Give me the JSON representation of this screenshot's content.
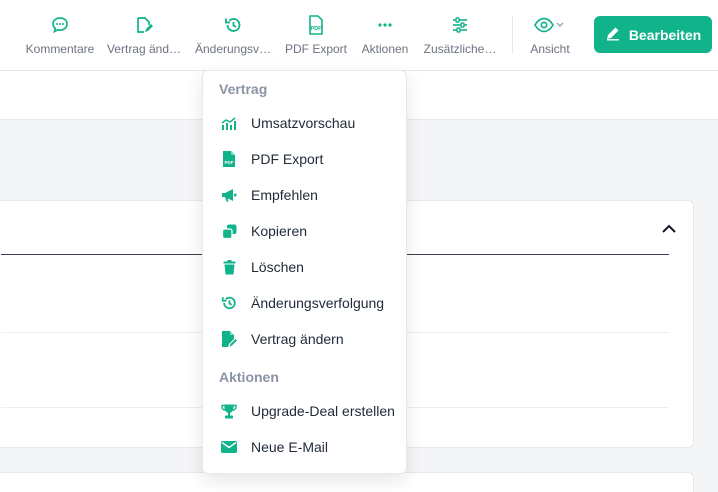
{
  "toolbar": {
    "items": [
      {
        "label": "Kommentare",
        "icon": "comment-icon"
      },
      {
        "label": "Vertrag änd…",
        "icon": "edit-document-icon"
      },
      {
        "label": "Änderungsv…",
        "icon": "history-icon"
      },
      {
        "label": "PDF Export",
        "icon": "pdf-icon"
      },
      {
        "label": "Aktionen",
        "icon": "more-dots-icon"
      },
      {
        "label": "Zusätzliche…",
        "icon": "sliders-icon"
      },
      {
        "label": "Ansicht",
        "icon": "eye-icon"
      }
    ],
    "edit_label": "Bearbeiten"
  },
  "menu": {
    "sections": [
      {
        "title": "Vertrag",
        "items": [
          {
            "label": "Umsatzvorschau",
            "icon": "chart-icon"
          },
          {
            "label": "PDF Export",
            "icon": "pdf-file-icon"
          },
          {
            "label": "Empfehlen",
            "icon": "megaphone-icon"
          },
          {
            "label": "Kopieren",
            "icon": "copy-icon"
          },
          {
            "label": "Löschen",
            "icon": "trash-icon"
          },
          {
            "label": "Änderungsverfolgung",
            "icon": "history-icon"
          },
          {
            "label": "Vertrag ändern",
            "icon": "edit-document-icon"
          }
        ]
      },
      {
        "title": "Aktionen",
        "items": [
          {
            "label": "Upgrade-Deal erstellen",
            "icon": "trophy-icon"
          },
          {
            "label": "Neue E-Mail",
            "icon": "envelope-icon"
          }
        ]
      }
    ]
  },
  "colors": {
    "accent": "#10b38a",
    "muted_text": "#6b7280",
    "section_title": "#8a94a3"
  }
}
